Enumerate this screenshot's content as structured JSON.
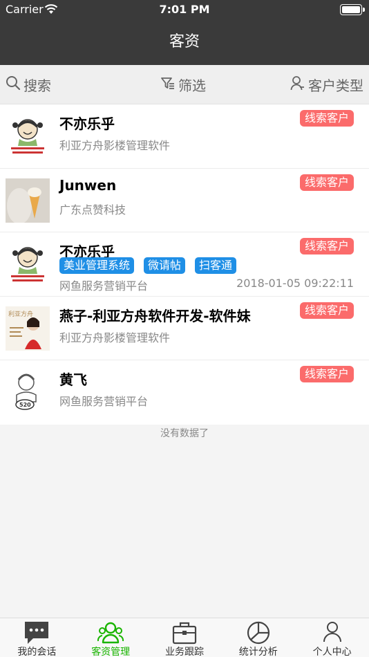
{
  "status_bar": {
    "carrier": "Carrier",
    "time": "7:01 PM"
  },
  "nav": {
    "title": "客资"
  },
  "filters": {
    "search": "搜索",
    "filter": "筛选",
    "customer_type": "客户类型"
  },
  "customers": [
    {
      "name": "不亦乐乎",
      "company": "利亚方舟影楼管理软件",
      "badge": "线索客户",
      "tags": [],
      "timestamp": ""
    },
    {
      "name": "Junwen",
      "company": "广东点赞科技",
      "badge": "线索客户",
      "tags": [],
      "timestamp": ""
    },
    {
      "name": "不亦乐乎",
      "company": "网鱼服务营销平台",
      "badge": "线索客户",
      "tags": [
        "美业管理系统",
        "微请帖",
        "扫客通"
      ],
      "timestamp": "2018-01-05 09:22:11"
    },
    {
      "name": "燕子-利亚方舟软件开发-软件妹",
      "company": "利亚方舟影楼管理软件",
      "badge": "线索客户",
      "tags": [],
      "timestamp": ""
    },
    {
      "name": "黄飞",
      "company": "网鱼服务营销平台",
      "badge": "线索客户",
      "tags": [],
      "timestamp": ""
    }
  ],
  "list_footer": "没有数据了",
  "tabs": [
    {
      "label": "我的会话",
      "icon": "chat-bubble-icon",
      "active": false
    },
    {
      "label": "客资管理",
      "icon": "people-group-icon",
      "active": true
    },
    {
      "label": "业务跟踪",
      "icon": "briefcase-icon",
      "active": false
    },
    {
      "label": "统计分析",
      "icon": "pie-chart-icon",
      "active": false
    },
    {
      "label": "个人中心",
      "icon": "person-icon",
      "active": false
    }
  ],
  "colors": {
    "header_bg": "#3a3a3a",
    "badge": "#fb6b6b",
    "tag": "#1f8fe6",
    "active_tab": "#19b400"
  }
}
